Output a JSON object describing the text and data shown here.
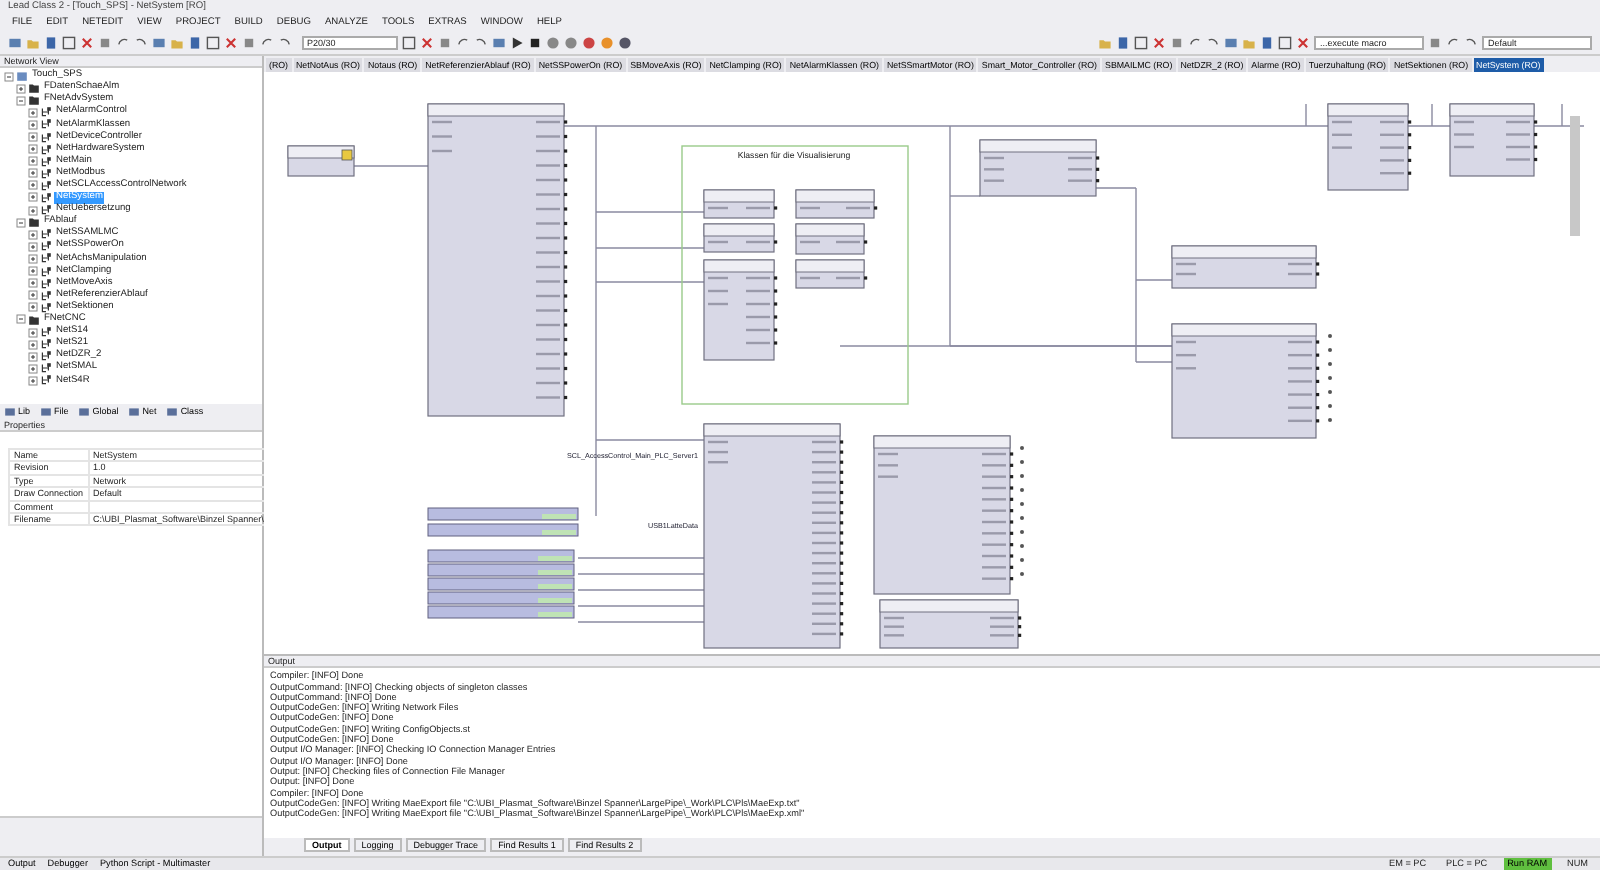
{
  "window": {
    "title": "Lead Class 2 - [Touch_SPS] - NetSystem [RO]"
  },
  "menu": [
    "FILE",
    "EDIT",
    "NETEDIT",
    "VIEW",
    "PROJECT",
    "BUILD",
    "DEBUG",
    "ANALYZE",
    "TOOLS",
    "EXTRAS",
    "WINDOW",
    "HELP"
  ],
  "toolbar": {
    "target_combo": "P20/30",
    "macro_combo": "...execute macro",
    "layout_combo": "Default"
  },
  "network_view": {
    "title": "Network View",
    "tree": [
      {
        "label": "Touch_SPS",
        "kind": "project",
        "expanded": true,
        "children": [
          {
            "label": "FDatenSchaeAlm",
            "kind": "folder",
            "expanded": false
          },
          {
            "label": "FNetAdvSystem",
            "kind": "folder",
            "expanded": true,
            "children": [
              {
                "label": "NetAlarmControl",
                "kind": "network",
                "expanded": false,
                "selected": false
              },
              {
                "label": "NetAlarmKlassen",
                "kind": "network",
                "expanded": false,
                "selected": false
              },
              {
                "label": "NetDeviceController",
                "kind": "network",
                "expanded": false,
                "selected": false
              },
              {
                "label": "NetHardwareSystem",
                "kind": "network",
                "expanded": false,
                "selected": false
              },
              {
                "label": "NetMain",
                "kind": "network",
                "expanded": false,
                "selected": false
              },
              {
                "label": "NetModbus",
                "kind": "network",
                "expanded": false,
                "selected": false
              },
              {
                "label": "NetSCLAccessControlNetwork",
                "kind": "network",
                "expanded": false,
                "selected": false
              },
              {
                "label": "NetSystem",
                "kind": "network",
                "expanded": false,
                "selected": true
              },
              {
                "label": "NetUebersetzung",
                "kind": "network",
                "expanded": false,
                "selected": false
              }
            ]
          },
          {
            "label": "FAblauf",
            "kind": "folder",
            "expanded": true,
            "children": [
              {
                "label": "NetSSAMLMC",
                "kind": "network",
                "expanded": false,
                "selected": false
              },
              {
                "label": "NetSSPowerOn",
                "kind": "network",
                "expanded": false,
                "selected": false
              },
              {
                "label": "NetAchsManipulation",
                "kind": "network",
                "expanded": false,
                "selected": false
              },
              {
                "label": "NetClamping",
                "kind": "network",
                "expanded": false,
                "selected": false
              },
              {
                "label": "NetMoveAxis",
                "kind": "network",
                "expanded": false,
                "selected": false
              },
              {
                "label": "NetReferenzierAblauf",
                "kind": "network",
                "expanded": false,
                "selected": false
              },
              {
                "label": "NetSektionen",
                "kind": "network",
                "expanded": false,
                "selected": false
              }
            ]
          },
          {
            "label": "FNetCNC",
            "kind": "folder",
            "expanded": true,
            "children": [
              {
                "label": "NetS14",
                "kind": "network",
                "expanded": false,
                "selected": false
              },
              {
                "label": "NetS21",
                "kind": "network",
                "expanded": false,
                "selected": false
              },
              {
                "label": "NetDZR_2",
                "kind": "network",
                "expanded": false,
                "selected": false
              },
              {
                "label": "NetSMAL",
                "kind": "network",
                "expanded": false,
                "selected": false
              },
              {
                "label": "NetS4R",
                "kind": "network",
                "expanded": false,
                "selected": false
              }
            ]
          }
        ]
      }
    ]
  },
  "view_tabs": [
    "Lib",
    "File",
    "Global",
    "Net",
    "Class"
  ],
  "properties": {
    "title": "Properties",
    "rows": [
      {
        "name": "Name",
        "value": "NetSystem"
      },
      {
        "name": "Revision",
        "value": "1.0"
      },
      {
        "name": "Type",
        "value": "Network"
      },
      {
        "name": "Draw Connection",
        "value": "Default"
      },
      {
        "name": "Comment"
      },
      {
        "name": "Filename",
        "value": "C:\\UBI_Plasmat_Software\\Binzel Spanner\\"
      }
    ]
  },
  "editor_tabs": [
    {
      "label": "(RO)",
      "selected": false
    },
    {
      "label": "NetNotAus (RO)",
      "selected": false
    },
    {
      "label": "Notaus (RO)",
      "selected": false
    },
    {
      "label": "NetReferenzierAblauf (RO)",
      "selected": false
    },
    {
      "label": "NetSSPowerOn (RO)",
      "selected": false
    },
    {
      "label": "SBMoveAxis (RO)",
      "selected": false
    },
    {
      "label": "NetClamping (RO)",
      "selected": false
    },
    {
      "label": "NetAlarmKlassen (RO)",
      "selected": false
    },
    {
      "label": "NetSSmartMotor (RO)",
      "selected": false
    },
    {
      "label": "Smart_Motor_Controller (RO)",
      "selected": false
    },
    {
      "label": "SBMAILMC (RO)",
      "selected": false
    },
    {
      "label": "NetDZR_2 (RO)",
      "selected": false
    },
    {
      "label": "Alarme (RO)",
      "selected": false
    },
    {
      "label": "Tuerzuhaltung (RO)",
      "selected": false
    },
    {
      "label": "NetSektionen (RO)",
      "selected": false
    },
    {
      "label": "NetSystem (RO)",
      "selected": true
    }
  ],
  "diagram": {
    "group_label": "Klassen für die Visualisierung",
    "signal_labels": [
      "SCL_AccessControl_Main_PLC_Server1",
      "USB1LatteData"
    ]
  },
  "output": {
    "title": "Output",
    "lines": [
      "Compiler: [INFO] Done",
      "OutputCommand: [INFO] Checking objects of singleton classes",
      "OutputCommand: [INFO] Done",
      "OutputCodeGen: [INFO] Writing Network Files",
      "OutputCodeGen: [INFO] Done",
      "OutputCodeGen: [INFO] Writing ConfigObjects.st",
      "OutputCodeGen: [INFO] Done",
      "Output I/O Manager: [INFO] Checking IO Connection Manager Entries",
      "Output I/O Manager: [INFO] Done",
      "Output: [INFO] Checking files of Connection File Manager",
      "Output: [INFO] Done",
      "Compiler: [INFO] Done",
      "OutputCodeGen: [INFO] Writing MaeExport file \"C:\\UBI_Plasmat_Software\\Binzel Spanner\\LargePipe\\_Work\\PLC\\Pls\\MaeExp.txt\"",
      "OutputCodeGen: [INFO] Writing MaeExport file \"C:\\UBI_Plasmat_Software\\Binzel Spanner\\LargePipe\\_Work\\PLC\\Pls\\MaeExp.xml\""
    ],
    "tabs": [
      {
        "label": "Output",
        "selected": true
      },
      {
        "label": "Logging",
        "selected": false
      },
      {
        "label": "Debugger Trace",
        "selected": false
      },
      {
        "label": "Find Results 1",
        "selected": false
      },
      {
        "label": "Find Results 2",
        "selected": false
      }
    ]
  },
  "status_bar": {
    "panels": [
      "Output",
      "Debugger",
      "Python Script - Multimaster"
    ],
    "indicators": [
      {
        "text": "EM = PC",
        "on": false
      },
      {
        "text": "PLC = PC",
        "on": false
      },
      {
        "text": "Run RAM",
        "on": true
      },
      {
        "text": "NUM",
        "on": false
      }
    ]
  }
}
